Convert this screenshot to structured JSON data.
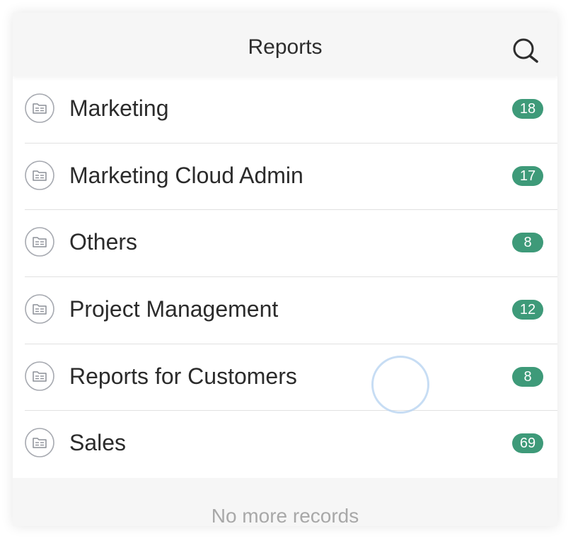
{
  "header": {
    "title": "Reports",
    "search_icon": "search-icon"
  },
  "folders": [
    {
      "label": "Marketing",
      "count": "18",
      "icon": "folder-icon"
    },
    {
      "label": "Marketing Cloud Admin",
      "count": "17",
      "icon": "folder-icon"
    },
    {
      "label": "Others",
      "count": "8",
      "icon": "folder-icon"
    },
    {
      "label": "Project Management",
      "count": "12",
      "icon": "folder-icon"
    },
    {
      "label": "Reports for Customers",
      "count": "8",
      "icon": "folder-icon"
    },
    {
      "label": "Sales",
      "count": "69",
      "icon": "folder-icon"
    }
  ],
  "footer": {
    "text": "No more records"
  },
  "colors": {
    "badge": "#3e9a79",
    "header_bg": "#f6f6f6",
    "text": "#2b2b2b",
    "muted_text": "#a8a8a8"
  }
}
